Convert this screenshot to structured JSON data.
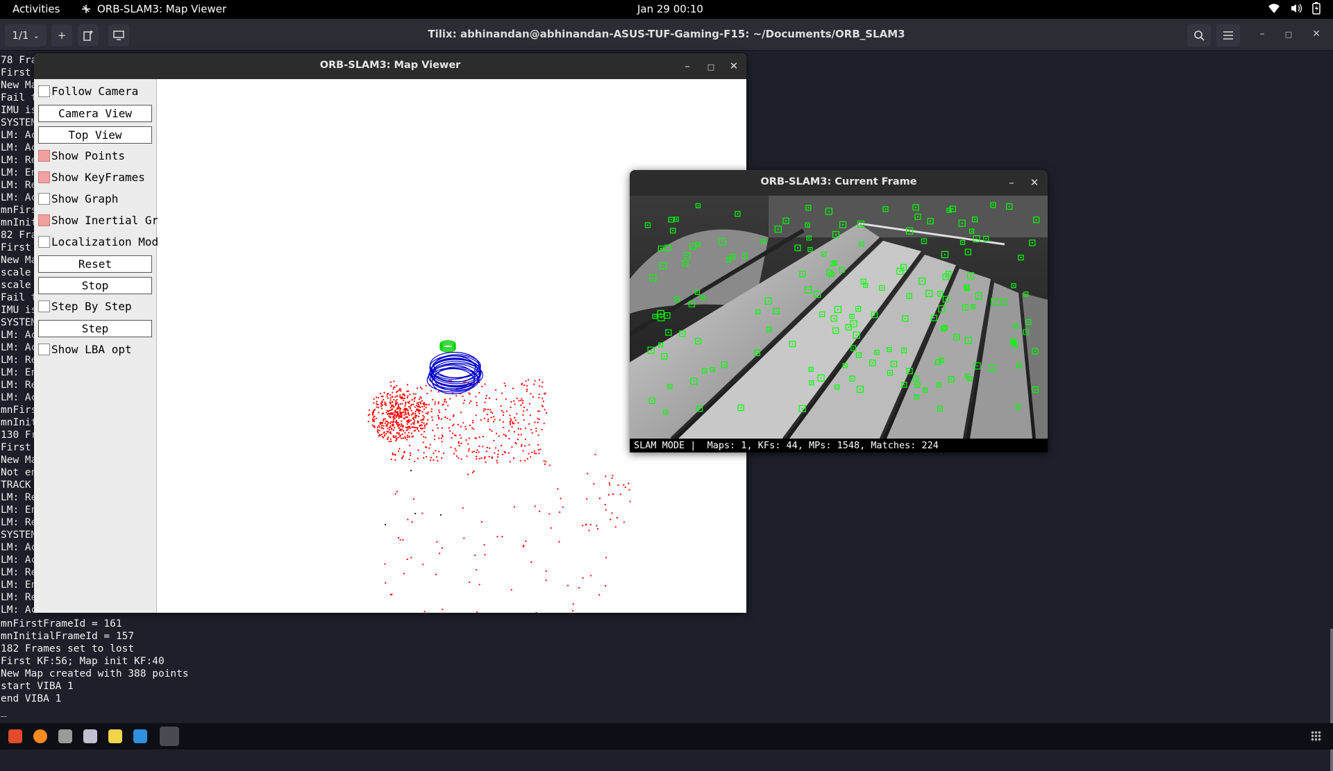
{
  "topbar": {
    "activities": "Activities",
    "app_name": "ORB-SLAM3: Map Viewer",
    "clock": "Jan 29  00:10"
  },
  "tilix": {
    "session_selector": "1/1",
    "title": "Tilix: abhinandan@abhinandan-ASUS-TUF-Gaming-F15: ~/Documents/ORB_SLAM3"
  },
  "terminal": {
    "hidden_lines": [
      "78 Fra",
      "First",
      "New Ma",
      "Fail t",
      "IMU is",
      "SYSTEM",
      "LM: Ac",
      "LM: Ac",
      "LM: Re",
      "LM: En",
      "LM: Re",
      "LM: Ac",
      "mnFirs",
      "mnInit",
      "82 Fra",
      "First",
      "New Ma",
      "scale",
      "scale",
      "Fail t",
      "IMU is",
      "SYSTEM",
      "LM: Ac",
      "LM: Ac",
      "LM: Re",
      "LM: En",
      "LM: Re",
      "LM: Ac",
      "mnFirs",
      "mnInit",
      "130 Fr",
      "First",
      "New Ma",
      "Not en",
      "TRACK",
      "LM: Re",
      "LM: En",
      "LM: Re",
      "SYSTEM",
      "LM: Ac",
      "LM: Ac",
      "LM: Re",
      "LM: En",
      "LM: Re",
      "LM: Ac"
    ],
    "visible_lines": [
      "mnFirstFrameId = 161",
      "mnInitialFrameId = 157",
      "182 Frames set to lost",
      "First KF:56; Map init KF:40",
      "New Map created with 388 points",
      "start VIBA 1",
      "end VIBA 1",
      "_"
    ]
  },
  "map_viewer": {
    "title": "ORB-SLAM3: Map Viewer",
    "panel": [
      {
        "type": "checkbox",
        "label": "Follow Camera",
        "checked": false
      },
      {
        "type": "button",
        "label": "Camera View"
      },
      {
        "type": "button",
        "label": "Top View"
      },
      {
        "type": "checkbox",
        "label": "Show Points",
        "checked": true
      },
      {
        "type": "checkbox",
        "label": "Show KeyFrames",
        "checked": true
      },
      {
        "type": "checkbox",
        "label": "Show Graph",
        "checked": false
      },
      {
        "type": "checkbox",
        "label": "Show Inertial Graph",
        "checked": true
      },
      {
        "type": "checkbox",
        "label": "Localization Mode",
        "checked": false
      },
      {
        "type": "button",
        "label": "Reset"
      },
      {
        "type": "button",
        "label": "Stop"
      },
      {
        "type": "checkbox",
        "label": "Step By Step",
        "checked": false
      },
      {
        "type": "button",
        "label": "Step"
      },
      {
        "type": "checkbox",
        "label": "Show LBA opt",
        "checked": false
      }
    ],
    "colors": {
      "map_points": "#ff0000",
      "keyframes": "#0000cc",
      "current_camera": "#00cc00"
    }
  },
  "current_frame": {
    "title": "ORB-SLAM3: Current Frame",
    "status": "SLAM MODE |  Maps: 1, KFs: 44, MPs: 1548, Matches: 224",
    "feature_color": "#00ff00"
  }
}
